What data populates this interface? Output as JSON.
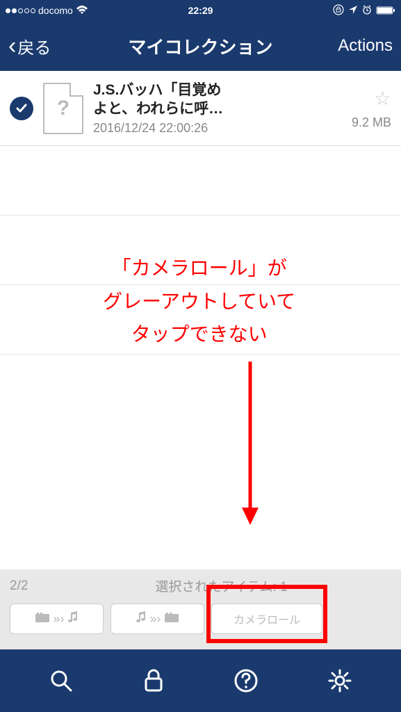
{
  "status": {
    "carrier": "docomo",
    "time": "22:29"
  },
  "nav": {
    "back_label": "戻る",
    "title": "マイコレクション",
    "actions_label": "Actions"
  },
  "list": {
    "items": [
      {
        "title_line1": "J.S.バッハ「目覚め",
        "title_line2": "よと、われらに呼…",
        "date": "2016/12/24 22:00:26",
        "size": "9.2 MB"
      }
    ]
  },
  "annotation": {
    "line1": "「カメラロール」が",
    "line2": "グレーアウトしていて",
    "line3": "タップできない"
  },
  "footer": {
    "counter": "2/2",
    "selected_label": "選択されたアイテム: 1",
    "camera_roll_label": "カメラロール"
  }
}
